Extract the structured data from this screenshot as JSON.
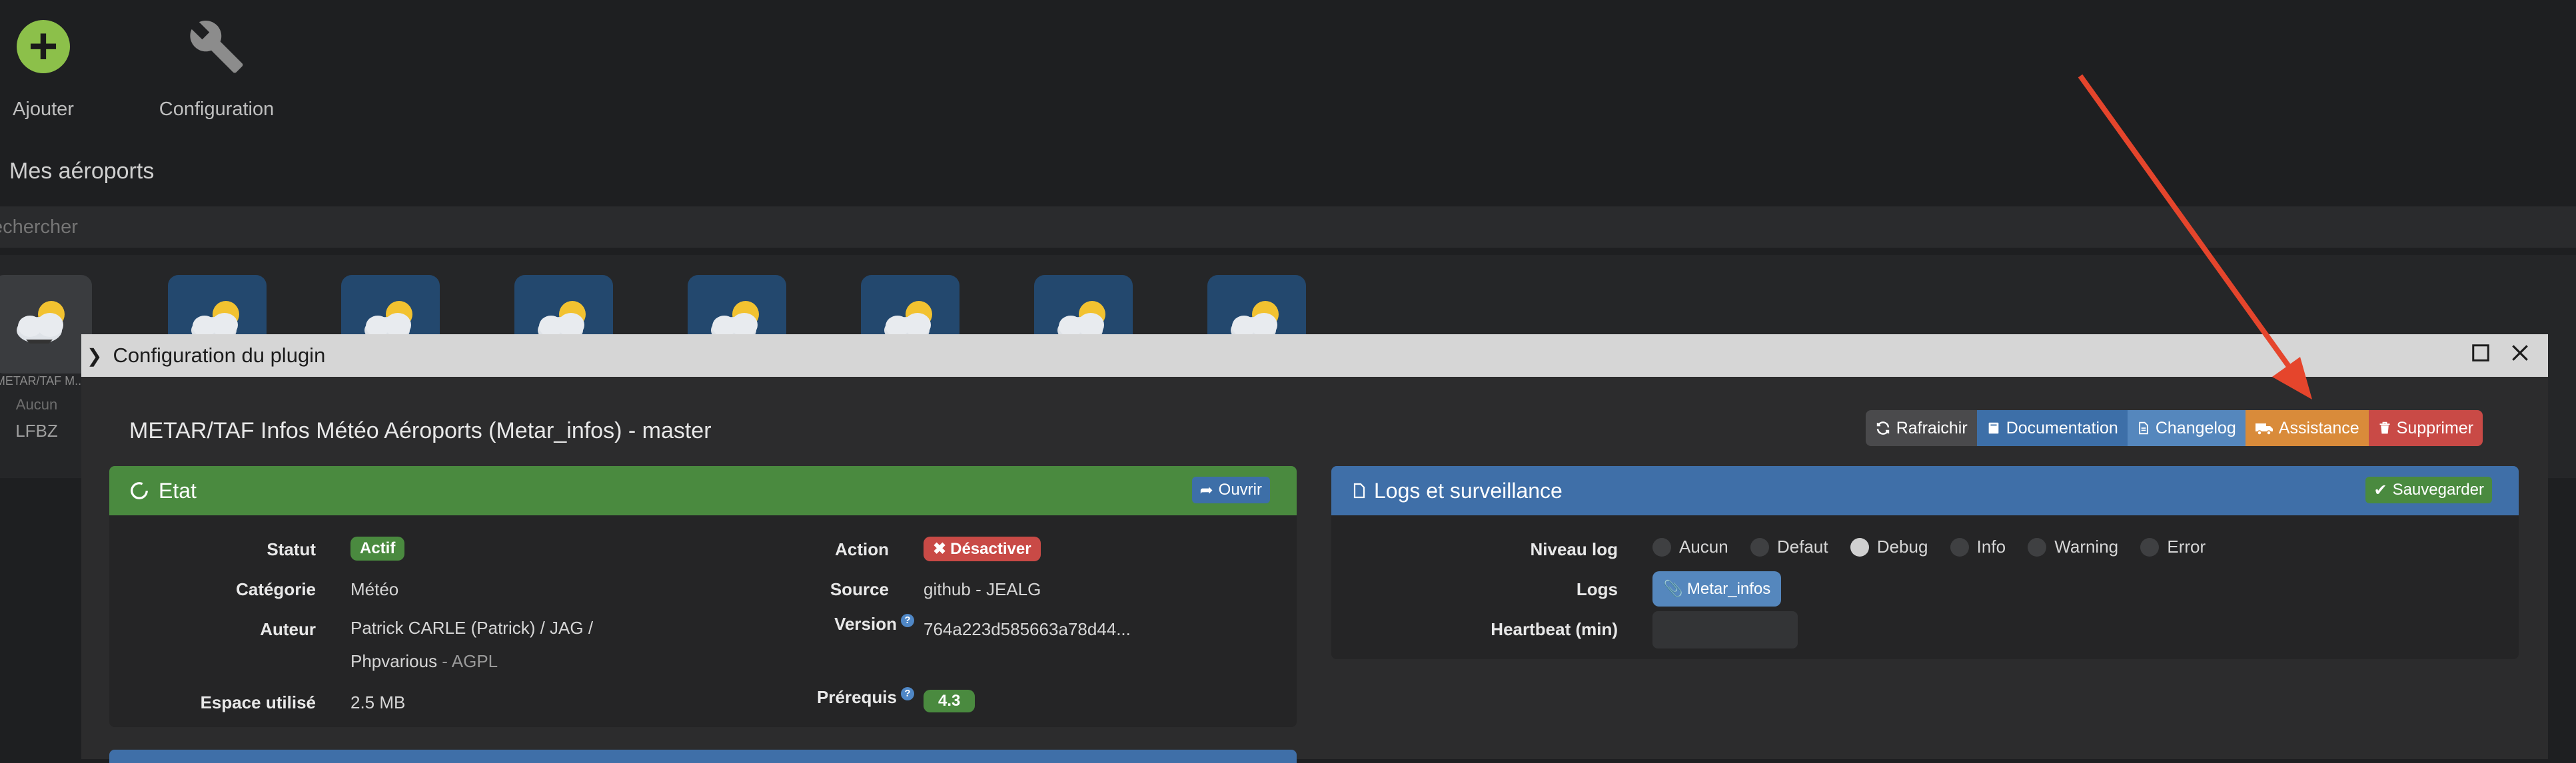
{
  "background": {
    "actions": [
      {
        "label": "Ajouter",
        "icon": "plus-circle-icon"
      },
      {
        "label": "Configuration",
        "icon": "wrench-icon"
      }
    ],
    "section_title": "Mes aéroports",
    "search_placeholder": "echercher",
    "tiles": [
      {
        "caption": "METAR/TAF M...",
        "sub": "Aucun",
        "code": "LFBZ",
        "disabled": true
      },
      {
        "caption": "",
        "disabled": false
      },
      {
        "caption": "",
        "disabled": false
      },
      {
        "caption": "",
        "disabled": false
      },
      {
        "caption": "",
        "disabled": false
      },
      {
        "caption": "",
        "disabled": false
      },
      {
        "caption": "",
        "disabled": false
      },
      {
        "caption": "",
        "disabled": false
      }
    ]
  },
  "modal": {
    "title": "Configuration du plugin",
    "plugin_title": "METAR/TAF Infos Météo Aéroports (Metar_infos) - master",
    "toolbar": [
      {
        "label": "Rafraichir",
        "icon": "refresh-icon",
        "color": "#4a4a4c"
      },
      {
        "label": "Documentation",
        "icon": "book-icon",
        "color": "#3d6fa8"
      },
      {
        "label": "Changelog",
        "icon": "file-icon",
        "color": "#5587bd"
      },
      {
        "label": "Assistance",
        "icon": "truck-icon",
        "color": "#d98b3a"
      },
      {
        "label": "Supprimer",
        "icon": "trash-icon",
        "color": "#c94a46"
      }
    ],
    "etat": {
      "title": "Etat",
      "open_label": "Ouvrir",
      "header_color": "#4a8a3f",
      "statut_label": "Statut",
      "statut_value": "Actif",
      "categorie_label": "Catégorie",
      "categorie_value": "Météo",
      "auteur_label": "Auteur",
      "auteur_line1": "Patrick CARLE (Patrick) / JAG /",
      "auteur_line2": "Phpvarious",
      "auteur_license": " - AGPL",
      "espace_label": "Espace utilisé",
      "espace_value": "2.5 MB",
      "action_label": "Action",
      "action_value": "Désactiver",
      "source_label": "Source",
      "source_value": "github - JEALG",
      "version_label": "Version",
      "version_value": "764a223d585663a78d44...",
      "prerequis_label": "Prérequis",
      "prerequis_value": "4.3"
    },
    "logs": {
      "title": "Logs et surveillance",
      "save_label": "Sauvegarder",
      "header_color": "#3f6fa8",
      "niveau_label": "Niveau log",
      "levels": [
        "Aucun",
        "Defaut",
        "Debug",
        "Info",
        "Warning",
        "Error"
      ],
      "selected_level": "Debug",
      "logs_label": "Logs",
      "logs_button": "Metar_infos",
      "heartbeat_label": "Heartbeat (min)",
      "heartbeat_value": ""
    }
  }
}
